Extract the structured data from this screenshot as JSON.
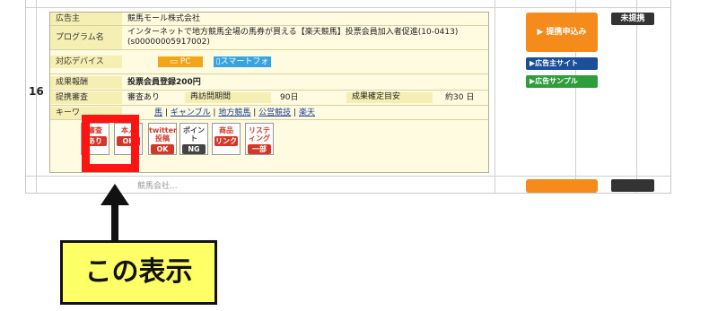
{
  "row": {
    "number": "16",
    "labels": {
      "advertiser": "広告主",
      "program": "プログラム名",
      "devices": "対応デバイス",
      "reward": "成果報酬",
      "review": "提携審査",
      "keywords": "キーワ"
    },
    "advertiser": "競馬モール株式会社",
    "program_name": "インターネットで地方競馬全場の馬券が買える【楽天競馬】投票会員加入者促進(10-0413)",
    "program_code": "(s00000005917002)",
    "devices": {
      "pc": "PC",
      "smartphone": "スマートフォン"
    },
    "reward_value": "投票会員登録200円",
    "review": {
      "value": "審査あり",
      "revisit_label": "再訪問期間",
      "revisit_value": "90日",
      "confirm_label": "成果確定目安",
      "confirm_value": "約30 日"
    },
    "keywords": {
      "first": "馬",
      "items": [
        "ギャンブル",
        "地方競馬",
        "公営競技",
        "楽天"
      ],
      "sep": "|"
    },
    "icons": [
      {
        "top": "審査",
        "bottom": "あり",
        "color": "#d1382a"
      },
      {
        "top": "本人",
        "bottom": "OK",
        "color": "#d1382a"
      },
      {
        "top": "twitter投稿",
        "bottom": "OK",
        "color": "#d1382a"
      },
      {
        "top": "ポイント",
        "bottom": "NG",
        "color": "#444444"
      },
      {
        "top": "商品",
        "bottom": "リンク",
        "color": "#d1382a"
      },
      {
        "top": "リスティング",
        "bottom": "一部OK",
        "color": "#d1382a"
      }
    ],
    "actions": {
      "apply": "▶ 提携申込み",
      "advertiser_site": "▶広告主サイト",
      "ad_sample": "▶広告サンプル"
    },
    "status": "未提携",
    "next_advertiser": "競馬会社..."
  },
  "annotation": {
    "label": "この表示"
  },
  "colors": {
    "highlight": "#ff1414",
    "callout_bg": "#ffff66",
    "apply": "#f58b1a",
    "site_btn": "#1b4f9c",
    "sample_btn": "#2e9e3c",
    "pc": "#f2a51a",
    "smartphone": "#38a3e0"
  }
}
